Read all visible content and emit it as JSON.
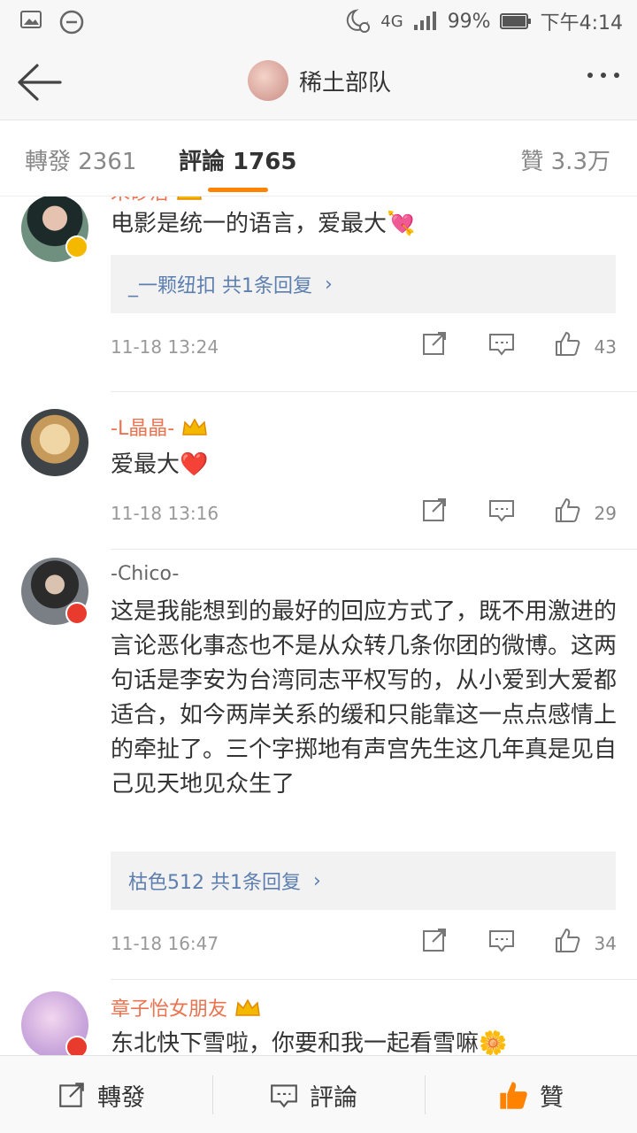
{
  "status_bar": {
    "network": "4G",
    "battery": "99%",
    "time": "下午4:14"
  },
  "header": {
    "title": "稀土部队"
  },
  "tabs": {
    "repost": "轉發 2361",
    "comments": "評論 1765",
    "likes": "贊 3.3万"
  },
  "comments": [
    {
      "user": "朱砂治",
      "text": "电影是统一的语言，爱最大💘",
      "reply": "_一颗纽扣  共1条回复",
      "time": "11-18 13:24",
      "likes": "43"
    },
    {
      "user": "-L晶晶-",
      "text": "爱最大❤️",
      "time": "11-18 13:16",
      "likes": "29"
    },
    {
      "user": "-Chico-",
      "text": "这是我能想到的最好的回应方式了，既不用激进的言论恶化事态也不是从众转几条你团的微博。这两句话是李安为台湾同志平权写的，从小爱到大爱都适合，如今两岸关系的缓和只能靠这一点点感情上的牵扯了。三个字掷地有声宫先生这几年真是见自己见天地见众生了",
      "reply": "枯色512  共1条回复",
      "time": "11-18 16:47",
      "likes": "34"
    },
    {
      "user": "章子怡女朋友",
      "text": "东北快下雪啦，你要和我一起看雪嘛🌼"
    }
  ],
  "bottom_bar": {
    "repost": "轉發",
    "comment": "評論",
    "like": "贊"
  },
  "colors": {
    "accent": "#ff8200",
    "username": "#eb7350",
    "link": "#5d7fb0"
  }
}
